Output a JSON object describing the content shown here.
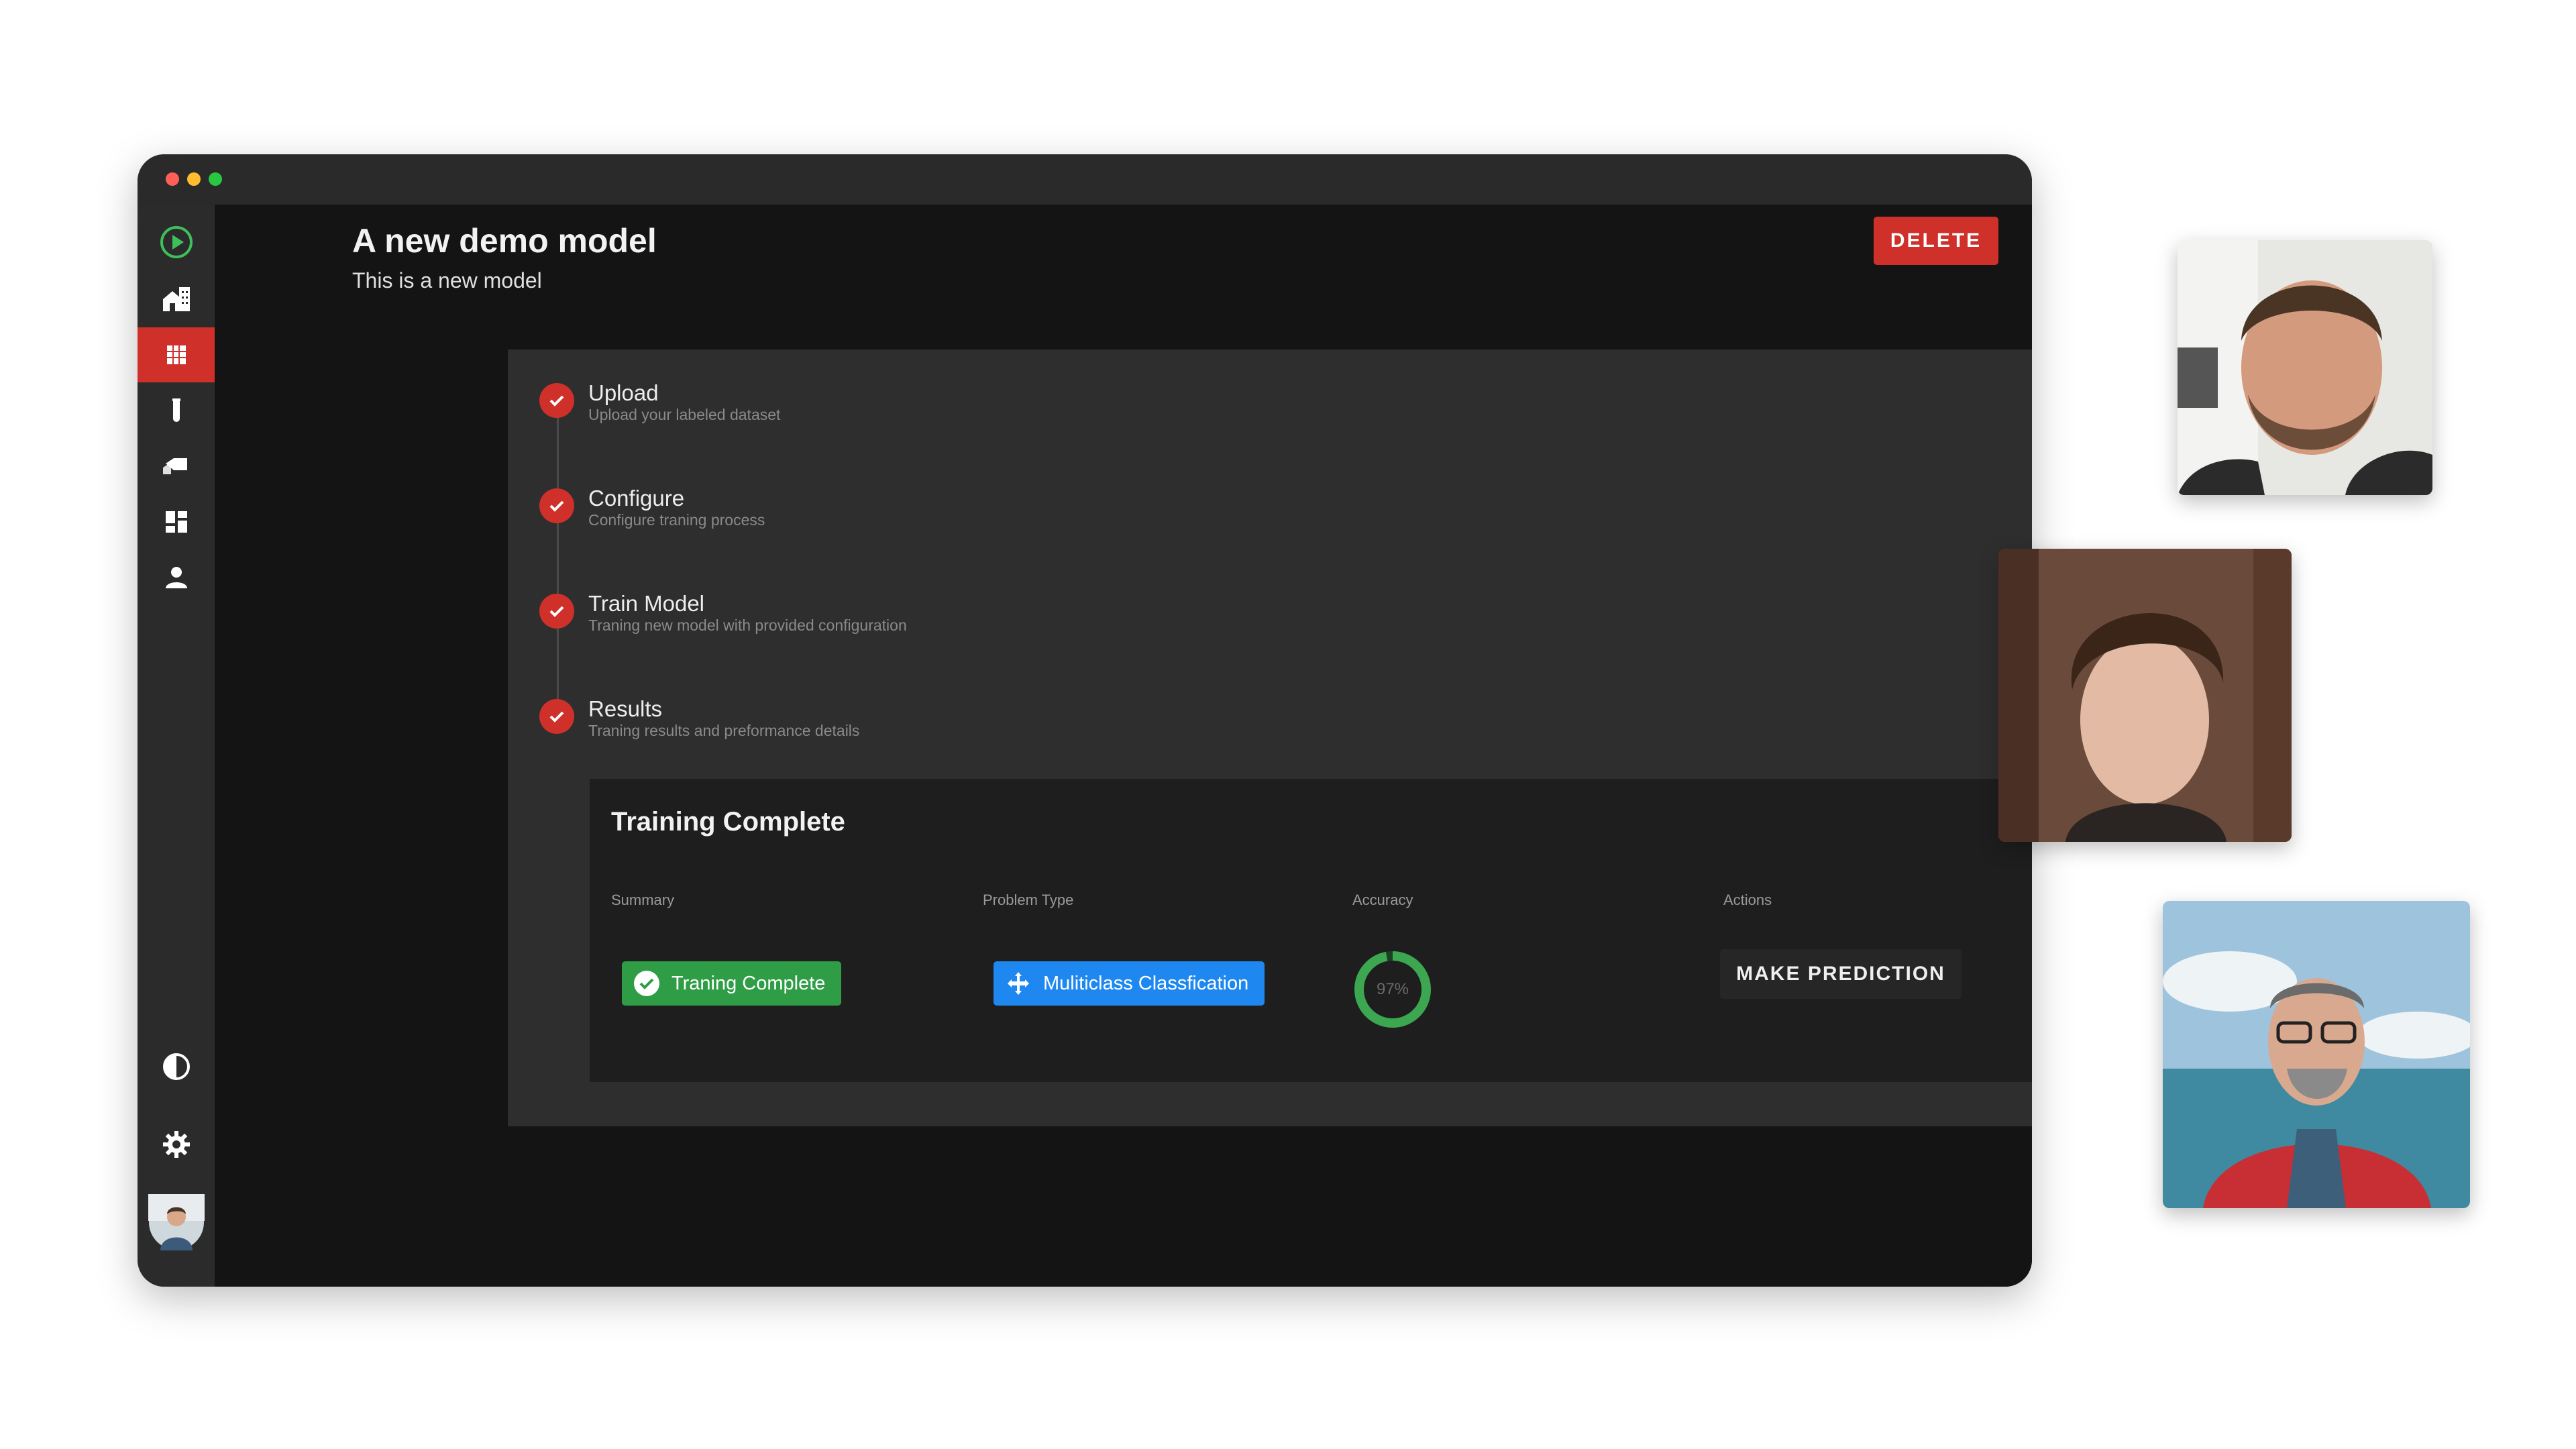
{
  "header": {
    "title": "A new demo model",
    "subtitle": "This is a new model",
    "delete_label": "DELETE"
  },
  "sidebar": {
    "items": [
      {
        "name": "logo",
        "icon": "play-circle-icon"
      },
      {
        "name": "home",
        "icon": "home-icon"
      },
      {
        "name": "models",
        "icon": "grid-icon",
        "active": true
      },
      {
        "name": "experiments",
        "icon": "test-tube-icon"
      },
      {
        "name": "labels",
        "icon": "tag-icon"
      },
      {
        "name": "dashboard",
        "icon": "dashboard-icon"
      },
      {
        "name": "account",
        "icon": "person-icon"
      },
      {
        "name": "theme",
        "icon": "contrast-icon"
      },
      {
        "name": "settings",
        "icon": "gear-icon"
      },
      {
        "name": "profile",
        "icon": "avatar"
      }
    ]
  },
  "steps": [
    {
      "title": "Upload",
      "desc": "Upload your labeled dataset"
    },
    {
      "title": "Configure",
      "desc": "Configure traning process"
    },
    {
      "title": "Train Model",
      "desc": "Traning new model with provided configuration"
    },
    {
      "title": "Results",
      "desc": "Traning results and preformance details"
    }
  ],
  "results": {
    "title": "Training Complete",
    "labels": {
      "summary": "Summary",
      "problem_type": "Problem Type",
      "accuracy": "Accuracy",
      "actions": "Actions"
    },
    "summary_chip": "Traning Complete",
    "problem_chip": "Muliticlass Classfication",
    "accuracy_text": "97%",
    "accuracy_fraction": 0.97,
    "predict_label": "MAKE PREDICTION"
  },
  "colors": {
    "accent": "#d0302a",
    "success": "#2e9d46",
    "info": "#1e88f0"
  },
  "participants": [
    {
      "name": "participant-1"
    },
    {
      "name": "participant-2"
    },
    {
      "name": "participant-3"
    }
  ]
}
